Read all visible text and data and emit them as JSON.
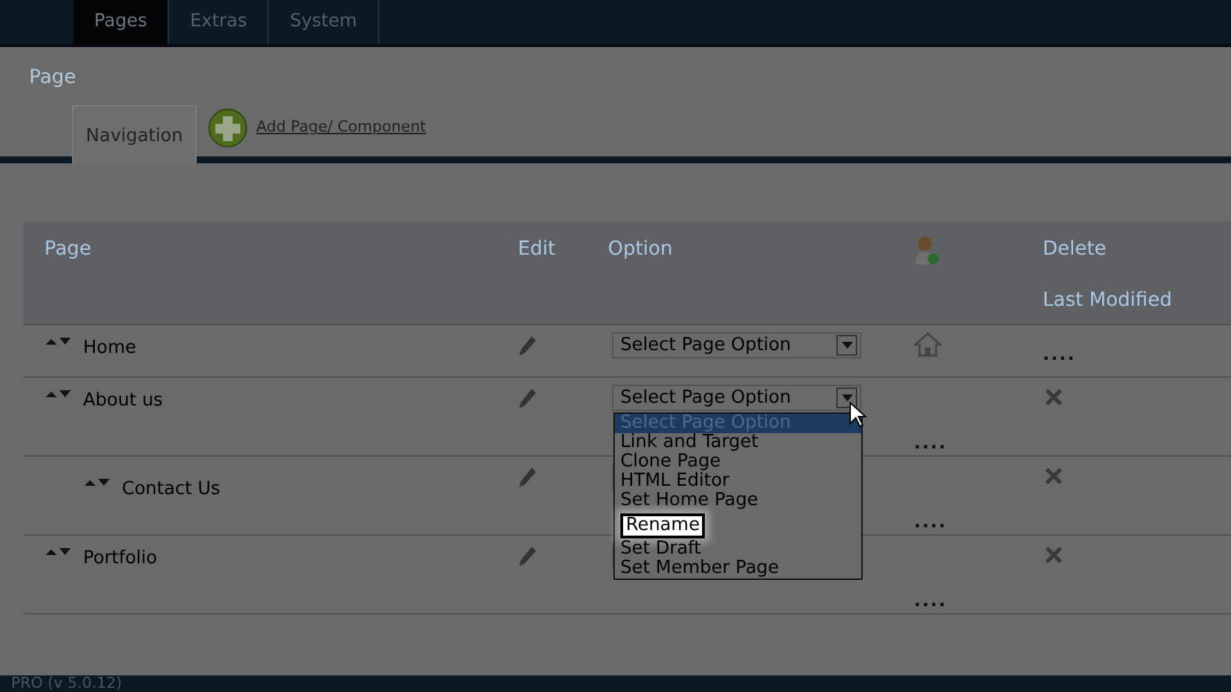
{
  "top_tabs": [
    {
      "label": "Pages",
      "selected": true
    },
    {
      "label": "Extras",
      "selected": false
    },
    {
      "label": "System",
      "selected": false
    }
  ],
  "breadcrumb": "Page",
  "sub_tabs": [
    {
      "label": "Navigation",
      "selected": true
    }
  ],
  "add_link": "Add Page/ Component",
  "table": {
    "columns": [
      "Page",
      "Edit",
      "Option",
      "Delete"
    ],
    "column_5": "Last Modified",
    "rows": [
      {
        "name": "Home",
        "kind": "home",
        "option": "Select Page Option",
        "last_modified": "....",
        "children": []
      },
      {
        "name": "About us",
        "kind": "page",
        "option": "Select Page Option",
        "last_modified": "....",
        "dropdown": {
          "open": true,
          "items": [
            {
              "label": "Select Page Option",
              "selected": true
            },
            {
              "label": "Link and Target",
              "selected": false
            },
            {
              "label": "Clone Page",
              "selected": false
            },
            {
              "label": "HTML Editor",
              "selected": false
            },
            {
              "label": "Set Home Page",
              "selected": false
            },
            {
              "label": "Set Draft",
              "selected": false
            },
            {
              "label": "Set Member Page",
              "selected": false
            }
          ],
          "callout": "Rename"
        },
        "children": [
          {
            "name": "Contact Us",
            "kind": "page",
            "last_modified": "...."
          }
        ]
      },
      {
        "name": "Portfolio",
        "kind": "page",
        "last_modified": "....",
        "children": []
      }
    ]
  },
  "status_bar": "PRO (v 5.0.12)"
}
